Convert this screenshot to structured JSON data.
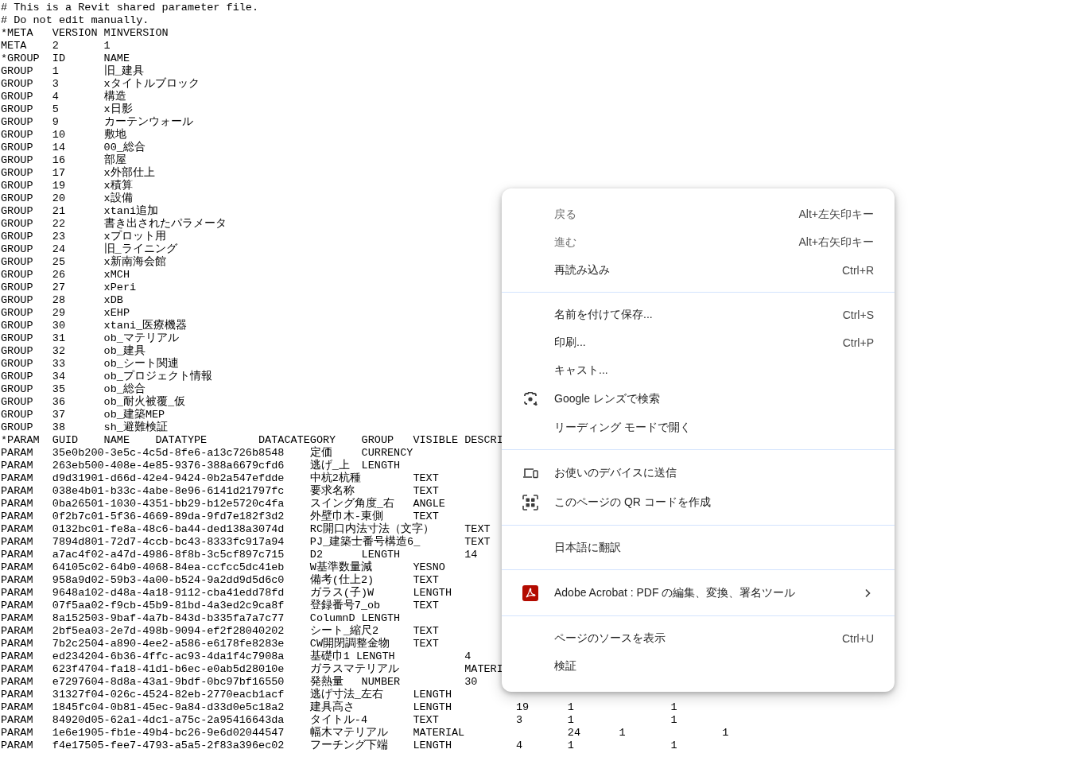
{
  "file_lines": [
    "# This is a Revit shared parameter file.",
    "# Do not edit manually.",
    "*META\tVERSION\tMINVERSION",
    "META\t2\t1",
    "*GROUP\tID\tNAME",
    "GROUP\t1\t旧_建具",
    "GROUP\t3\txタイトルブロック",
    "GROUP\t4\t構造",
    "GROUP\t5\tx日影",
    "GROUP\t9\tカーテンウォール",
    "GROUP\t10\t敷地",
    "GROUP\t14\t00_総合",
    "GROUP\t16\t部屋",
    "GROUP\t17\tx外部仕上",
    "GROUP\t19\tx積算",
    "GROUP\t20\tx設備",
    "GROUP\t21\txtani追加",
    "GROUP\t22\t書き出されたパラメータ",
    "GROUP\t23\txプロット用",
    "GROUP\t24\t旧_ライニング",
    "GROUP\t25\tx新南海会館",
    "GROUP\t26\txMCH",
    "GROUP\t27\txPeri",
    "GROUP\t28\txDB",
    "GROUP\t29\txEHP",
    "GROUP\t30\txtani_医療機器",
    "GROUP\t31\tob_マテリアル",
    "GROUP\t32\tob_建具",
    "GROUP\t33\tob_シート関連",
    "GROUP\t34\tob_プロジェクト情報",
    "GROUP\t35\tob_総合",
    "GROUP\t36\tob_耐火被覆_仮",
    "GROUP\t37\tob_建築MEP",
    "GROUP\t38\tsh_避難検証",
    "*PARAM\tGUID\tNAME\tDATATYPE\tDATACATEGORY\tGROUP\tVISIBLE\tDESCRI",
    "PARAM\t35e0b200-3e5c-4c5d-8fe6-a13c726b8548\t定価\tCURRENCY",
    "PARAM\t263eb500-408e-4e85-9376-388a6679cfd6\t逃げ_上\tLENGTH",
    "PARAM\td9d31901-d66d-42e4-9424-0b2a547efdde\t中杭2杭種\tTEXT",
    "PARAM\t038e4b01-b33c-4abe-8e96-6141d21797fc\t要求名称\tTEXT",
    "PARAM\t0ba26501-1030-4351-bb29-b12e5720c4fa\tスイング角度_右\tANGLE",
    "PARAM\t0f2b7c01-5f36-4669-89da-9fd7e182f3d2\t外壁巾木-東側\tTEXT",
    "PARAM\t0132bc01-fe8a-48c6-ba44-ded138a3074d\tRC開口内法寸法（文字）\tTEXT",
    "PARAM\t7894d801-72d7-4ccb-bc43-8333fc917a94\tPJ_建築士番号構造6_\tTEXT",
    "PARAM\ta7ac4f02-a47d-4986-8f8b-3c5cf897c715\tD2\tLENGTH\t\t14",
    "PARAM\t64105c02-64b0-4068-84ea-ccfcc5dc41eb\tW基準数量減\tYESNO",
    "PARAM\t958a9d02-59b3-4a00-b524-9a2dd9d5d6c0\t備考(仕上2)\tTEXT",
    "PARAM\t9648a102-d48a-4a18-9112-cba41edd78fd\tガラス(子)W\tLENGTH",
    "PARAM\t07f5aa02-f9cb-45b9-81bd-4a3ed2c9ca8f\t登録番号7_ob\tTEXT",
    "PARAM\t8a152503-9baf-4a7b-843d-b335fa7a7c77\tColumnD\tLENGTH",
    "PARAM\t2bf5ea03-2e7d-498b-9094-ef2f28040202\tシート_縮尺2\tTEXT",
    "PARAM\t7b2c2504-a890-4ee2-a586-e6178fe8283e\tCW開閉調整金物\tTEXT",
    "PARAM\ted234204-6b36-4ffc-ac93-4da1f4c7908a\t基礎巾1 LENGTH\t\t4",
    "PARAM\t623f4704-fa18-41d1-b6ec-e0ab5d28010e\tガラスマテリアル\tMATERI",
    "PARAM\te7297604-8d8a-43a1-9bdf-0bc97bf16550\t発熱量\tNUMBER\t\t30",
    "PARAM\t31327f04-026c-4524-82eb-2770eacb1acf\t逃げ寸法_左右\tLENGTH",
    "PARAM\t1845fc04-0b81-45ec-9a84-d33d0e5c18a2\t建具高さ\tLENGTH\t\t19\t1\t\t1",
    "PARAM\t84920d05-62a1-4dc1-a75c-2a95416643da\tタイトル-4\tTEXT\t\t3\t1\t\t1",
    "PARAM\t1e6e1905-fb1e-49b4-bc26-9e6d02044547\t幅木マテリアル\tMATERIAL\t\t24\t1\t\t1",
    "PARAM\tf4e17505-fee7-4793-a5a5-2f83a396ec02\tフーチング下端\tLENGTH\t\t4\t1\t\t1"
  ],
  "context_menu": {
    "sections": [
      {
        "items": [
          {
            "kind": "plain",
            "label": "戻る",
            "shortcut": "Alt+左矢印キー",
            "disabled": true
          },
          {
            "kind": "plain",
            "label": "進む",
            "shortcut": "Alt+右矢印キー",
            "disabled": true
          },
          {
            "kind": "plain",
            "label": "再読み込み",
            "shortcut": "Ctrl+R",
            "disabled": false
          }
        ]
      },
      {
        "items": [
          {
            "kind": "plain",
            "label": "名前を付けて保存...",
            "shortcut": "Ctrl+S",
            "disabled": false
          },
          {
            "kind": "plain",
            "label": "印刷...",
            "shortcut": "Ctrl+P",
            "disabled": false
          },
          {
            "kind": "plain",
            "label": "キャスト...",
            "disabled": false
          },
          {
            "kind": "lens",
            "label": "Google レンズで検索",
            "disabled": false
          },
          {
            "kind": "plain",
            "label": "リーディング モードで開く",
            "disabled": false
          }
        ]
      },
      {
        "items": [
          {
            "kind": "device",
            "label": "お使いのデバイスに送信",
            "disabled": false
          },
          {
            "kind": "qr",
            "label": "このページの QR コードを作成",
            "disabled": false
          }
        ]
      },
      {
        "items": [
          {
            "kind": "plain",
            "label": "日本語に翻訳",
            "disabled": false
          }
        ]
      },
      {
        "items": [
          {
            "kind": "extension",
            "label": "Adobe Acrobat : PDF の編集、変換、署名ツール",
            "submenu": true,
            "disabled": false
          }
        ]
      },
      {
        "items": [
          {
            "kind": "plain",
            "label": "ページのソースを表示",
            "shortcut": "Ctrl+U",
            "disabled": false
          },
          {
            "kind": "plain",
            "label": "検証",
            "disabled": false
          }
        ]
      }
    ]
  }
}
